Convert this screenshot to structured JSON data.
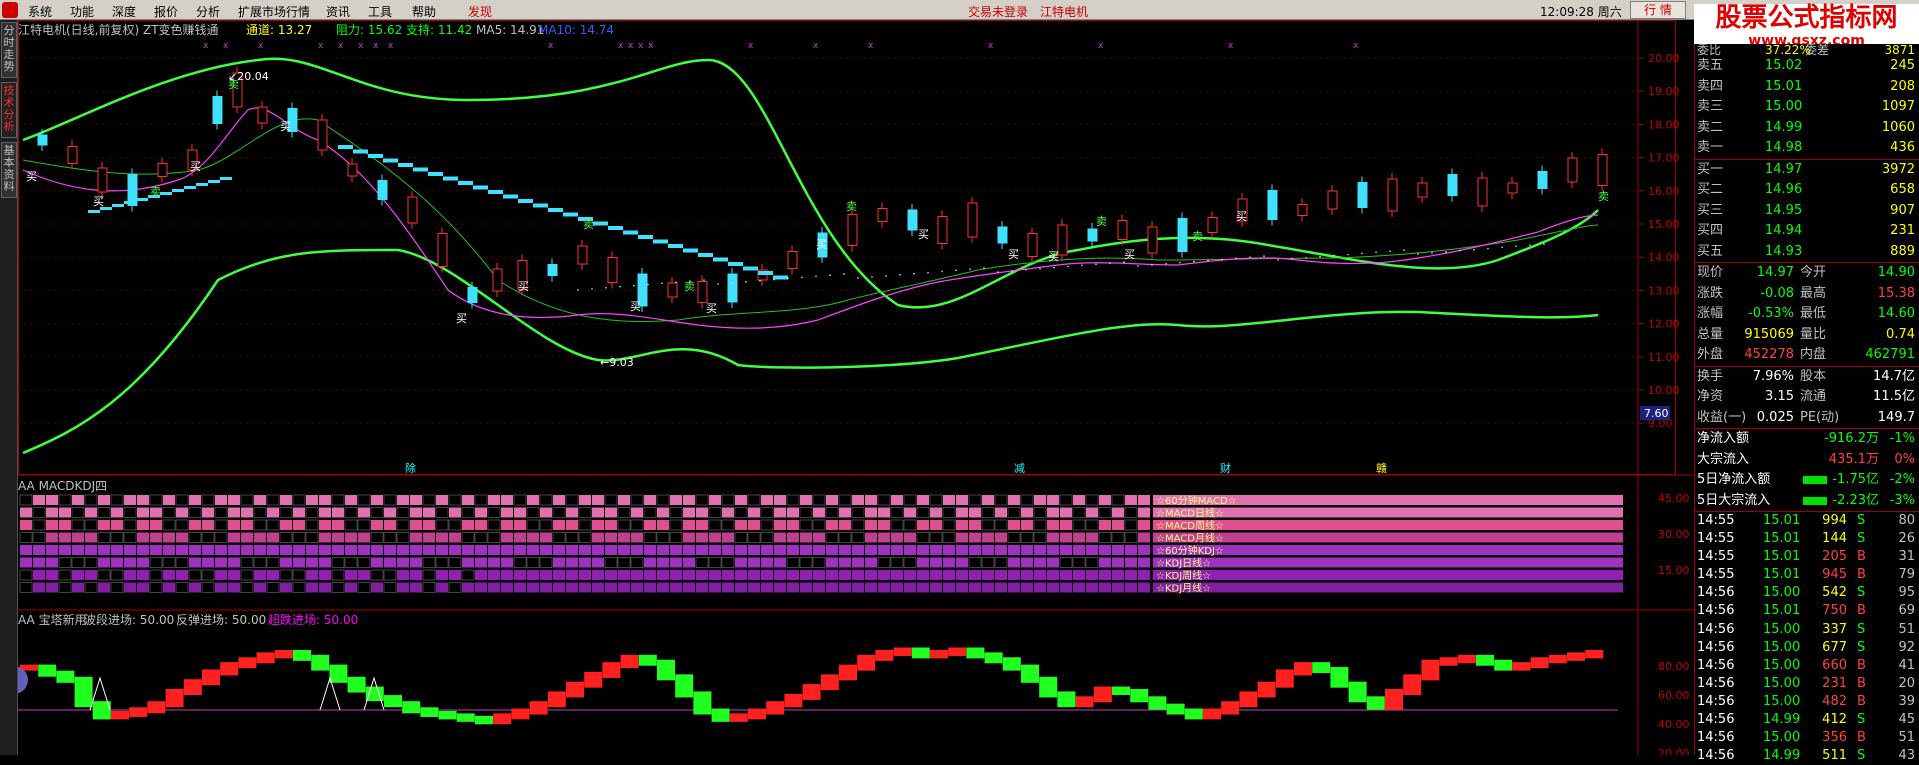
{
  "menu": {
    "items": [
      "系统",
      "功能",
      "深度",
      "报价",
      "分析",
      "扩展市场行情",
      "资讯",
      "工具",
      "帮助",
      "发现"
    ],
    "trade_status": "交易未登录",
    "stock_short": "江特电机",
    "time": "12:09:28 周六",
    "quote_btn": "行 情"
  },
  "watermark": {
    "text": "股票公式指标网",
    "url": "www.gsxz.com"
  },
  "side_tabs": [
    "分时走势",
    "技术分析",
    "基本资料"
  ],
  "main": {
    "title": "江特电机(日线,前复权) ZT变色赚钱通",
    "legend": [
      {
        "label": "通道: 13.27",
        "color": "#ffff00"
      },
      {
        "label": "阻力: 15.62",
        "color": "#00ff00"
      },
      {
        "label": "支持: 11.42",
        "color": "#00ff00"
      },
      {
        "label": "MA5: 14.91",
        "color": "#c0c0c0"
      },
      {
        "label": "MA10: 14.74",
        "color": "#3060ff"
      }
    ],
    "y_ticks": [
      "20.00",
      "19.00",
      "18.00",
      "17.00",
      "16.00",
      "15.00",
      "14.00",
      "13.00",
      "12.00",
      "11.00",
      "10.00",
      "9.00"
    ],
    "price_tag": "7.60",
    "high_label": "20.04",
    "low_label": "9.03",
    "buy_label": "买",
    "sell_label": "卖",
    "events": [
      "除",
      "减",
      "财",
      "赣"
    ]
  },
  "panel2": {
    "title": "AA MACDKDJ四",
    "y_ticks": [
      "45.00",
      "30.00",
      "15.00"
    ],
    "rows": [
      "☆60分钟MACD☆",
      "☆MACD日线☆",
      "☆MACD周线☆",
      "☆MACD月线☆",
      "☆60分钟KDJ☆",
      "☆KDJ日线☆",
      "☆KDJ周线☆",
      "☆KDJ月线☆"
    ]
  },
  "panel3": {
    "title": "AA 宝塔新用",
    "items": [
      {
        "label": "波段进场: 50.00",
        "color": "#c0c0c0"
      },
      {
        "label": "反弹进场: 50.00",
        "color": "#c0c0c0"
      },
      {
        "label": "超跌进场: 50.00",
        "color": "#ff00ff"
      }
    ],
    "y_ticks": [
      "80.00",
      "60.00",
      "40.00",
      "20.00"
    ]
  },
  "quote": {
    "header": {
      "l1": "委比",
      "v1": "37.22%",
      "l2": "委差",
      "v2": "3871"
    },
    "asks": [
      {
        "label": "卖五",
        "price": "15.02",
        "vol": "245"
      },
      {
        "label": "卖四",
        "price": "15.01",
        "vol": "208"
      },
      {
        "label": "卖三",
        "price": "15.00",
        "vol": "1097"
      },
      {
        "label": "卖二",
        "price": "14.99",
        "vol": "1060"
      },
      {
        "label": "卖一",
        "price": "14.98",
        "vol": "436"
      }
    ],
    "bids": [
      {
        "label": "买一",
        "price": "14.97",
        "vol": "3972"
      },
      {
        "label": "买二",
        "price": "14.96",
        "vol": "658"
      },
      {
        "label": "买三",
        "price": "14.95",
        "vol": "907"
      },
      {
        "label": "买四",
        "price": "14.94",
        "vol": "231"
      },
      {
        "label": "买五",
        "price": "14.93",
        "vol": "889"
      }
    ],
    "stats": [
      {
        "l1": "现价",
        "v1": "14.97",
        "c1": "#00ff00",
        "l2": "今开",
        "v2": "14.90",
        "c2": "#00ff00"
      },
      {
        "l1": "涨跌",
        "v1": "-0.08",
        "c1": "#00ff00",
        "l2": "最高",
        "v2": "15.38",
        "c2": "#ff4040"
      },
      {
        "l1": "涨幅",
        "v1": "-0.53%",
        "c1": "#00ff00",
        "l2": "最低",
        "v2": "14.60",
        "c2": "#00ff00"
      },
      {
        "l1": "总量",
        "v1": "915069",
        "c1": "#ffff00",
        "l2": "量比",
        "v2": "0.74",
        "c2": "#ffff00"
      },
      {
        "l1": "外盘",
        "v1": "452278",
        "c1": "#ff4040",
        "l2": "内盘",
        "v2": "462791",
        "c2": "#00ff00"
      }
    ],
    "stats2": [
      {
        "l1": "换手",
        "v1": "7.96%",
        "l2": "股本",
        "v2": "14.7亿"
      },
      {
        "l1": "净资",
        "v1": "3.15",
        "l2": "流通",
        "v2": "11.5亿"
      },
      {
        "l1": "收益(一)",
        "v1": "0.025",
        "l2": "PE(动)",
        "v2": "149.7"
      }
    ],
    "flows": [
      {
        "label": "净流入额",
        "val": "-916.2万",
        "pct": "-1%",
        "color": "#00ff00",
        "bar": false
      },
      {
        "label": "大宗流入",
        "val": "435.1万",
        "pct": "0%",
        "color": "#ff4040",
        "bar": false
      },
      {
        "label": "5日净流入额",
        "val": "-1.75亿",
        "pct": "-2%",
        "color": "#00ff00",
        "bar": true
      },
      {
        "label": "5日大宗流入",
        "val": "-2.23亿",
        "pct": "-3%",
        "color": "#00ff00",
        "bar": true
      }
    ],
    "ticks": [
      {
        "t": "14:55",
        "p": "15.01",
        "v": "994",
        "bs": "S",
        "n": "80"
      },
      {
        "t": "14:55",
        "p": "15.01",
        "v": "144",
        "bs": "S",
        "n": "26"
      },
      {
        "t": "14:55",
        "p": "15.01",
        "v": "205",
        "bs": "B",
        "n": "31"
      },
      {
        "t": "14:55",
        "p": "15.01",
        "v": "945",
        "bs": "B",
        "n": "79"
      },
      {
        "t": "14:56",
        "p": "15.00",
        "v": "542",
        "bs": "S",
        "n": "95"
      },
      {
        "t": "14:56",
        "p": "15.01",
        "v": "750",
        "bs": "B",
        "n": "69"
      },
      {
        "t": "14:56",
        "p": "15.00",
        "v": "337",
        "bs": "S",
        "n": "51"
      },
      {
        "t": "14:56",
        "p": "15.00",
        "v": "677",
        "bs": "S",
        "n": "92"
      },
      {
        "t": "14:56",
        "p": "15.00",
        "v": "660",
        "bs": "B",
        "n": "41"
      },
      {
        "t": "14:56",
        "p": "15.00",
        "v": "231",
        "bs": "B",
        "n": "20"
      },
      {
        "t": "14:56",
        "p": "15.00",
        "v": "482",
        "bs": "B",
        "n": "39"
      },
      {
        "t": "14:56",
        "p": "14.99",
        "v": "412",
        "bs": "S",
        "n": "45"
      },
      {
        "t": "14:56",
        "p": "15.00",
        "v": "356",
        "bs": "B",
        "n": "51"
      },
      {
        "t": "14:56",
        "p": "14.99",
        "v": "511",
        "bs": "S",
        "n": "43"
      }
    ]
  }
}
